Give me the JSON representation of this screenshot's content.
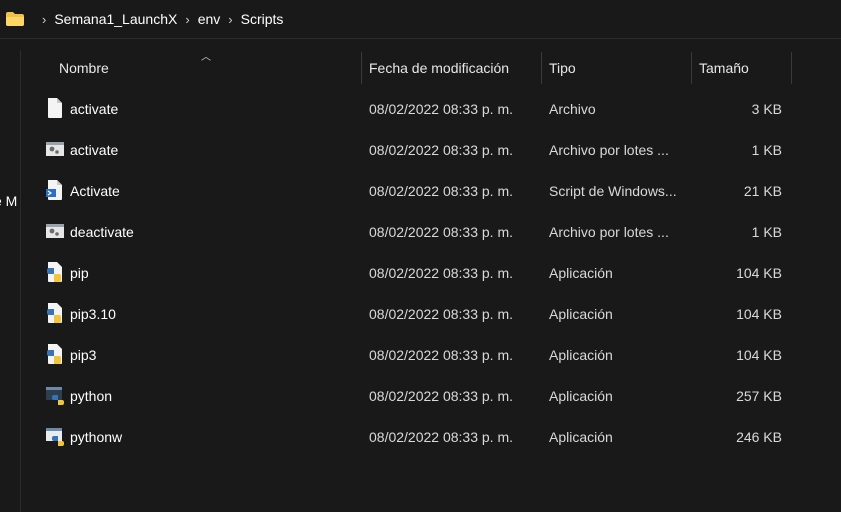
{
  "breadcrumb": [
    "Semana1_LaunchX",
    "env",
    "Scripts"
  ],
  "left_clip_text": "e M",
  "columns": {
    "name": "Nombre",
    "date": "Fecha de modificación",
    "type": "Tipo",
    "size": "Tamaño"
  },
  "files": [
    {
      "name": "activate",
      "date": "08/02/2022 08:33 p. m.",
      "type": "Archivo",
      "size": "3 KB",
      "icon": "file-icon"
    },
    {
      "name": "activate",
      "date": "08/02/2022 08:33 p. m.",
      "type": "Archivo por lotes ...",
      "size": "1 KB",
      "icon": "batch-file-icon"
    },
    {
      "name": "Activate",
      "date": "08/02/2022 08:33 p. m.",
      "type": "Script de Windows...",
      "size": "21 KB",
      "icon": "powershell-script-icon"
    },
    {
      "name": "deactivate",
      "date": "08/02/2022 08:33 p. m.",
      "type": "Archivo por lotes ...",
      "size": "1 KB",
      "icon": "batch-file-icon"
    },
    {
      "name": "pip",
      "date": "08/02/2022 08:33 p. m.",
      "type": "Aplicación",
      "size": "104 KB",
      "icon": "python-app-icon"
    },
    {
      "name": "pip3.10",
      "date": "08/02/2022 08:33 p. m.",
      "type": "Aplicación",
      "size": "104 KB",
      "icon": "python-app-icon"
    },
    {
      "name": "pip3",
      "date": "08/02/2022 08:33 p. m.",
      "type": "Aplicación",
      "size": "104 KB",
      "icon": "python-app-icon"
    },
    {
      "name": "python",
      "date": "08/02/2022 08:33 p. m.",
      "type": "Aplicación",
      "size": "257 KB",
      "icon": "python-console-icon"
    },
    {
      "name": "pythonw",
      "date": "08/02/2022 08:33 p. m.",
      "type": "Aplicación",
      "size": "246 KB",
      "icon": "python-window-icon"
    }
  ],
  "colors": {
    "background": "#191919",
    "folder": "#f0c24b",
    "text": "#ffffff"
  }
}
